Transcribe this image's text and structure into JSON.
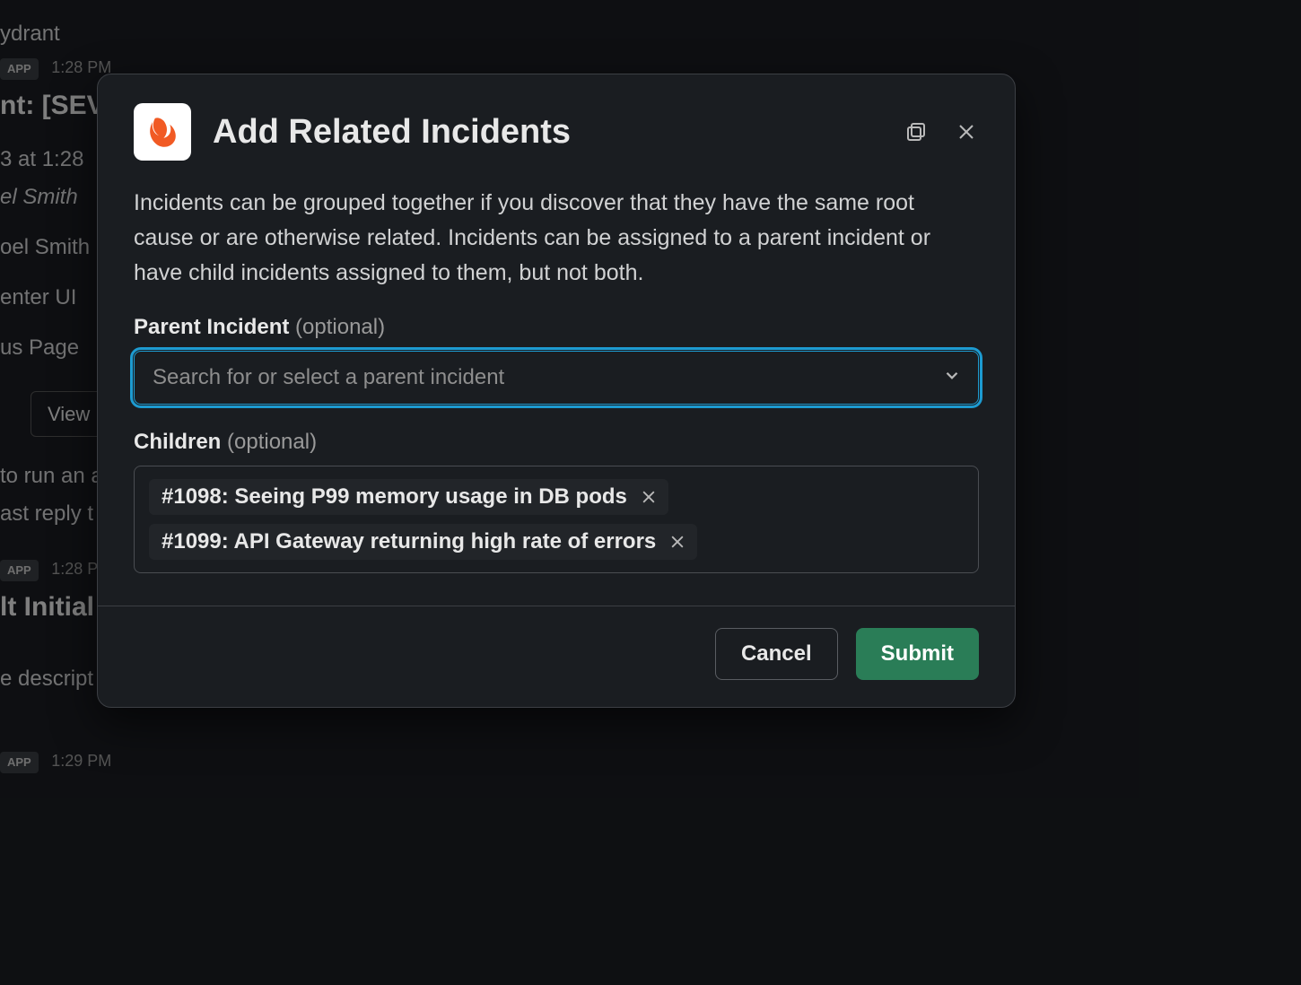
{
  "background": {
    "app_author": "ydrant",
    "app_badge": "APP",
    "time1": "1:28 PM",
    "headline_fragment": "nt: [SEV",
    "time_line": "3 at 1:28",
    "name1": "el Smith",
    "name2": "oel Smith",
    "link1": "enter UI",
    "link2": "us Page",
    "button_fragment": "View",
    "text_line1": "to run an a",
    "text_line2": "ast reply t",
    "time2": "1:28 P",
    "headline2_fragment": "lt Initial",
    "text_line3": "e descript",
    "time3": "1:29 PM"
  },
  "modal": {
    "title": "Add Related Incidents",
    "description": "Incidents can be grouped together if you discover that they have the same root cause or are otherwise related. Incidents can be assigned to a parent incident or have child incidents assigned to them, but not both.",
    "parent_label": "Parent Incident",
    "parent_optional": "(optional)",
    "parent_placeholder": "Search for or select a parent incident",
    "children_label": "Children",
    "children_optional": "(optional)",
    "children": [
      {
        "label": "#1098: Seeing P99 memory usage in DB pods"
      },
      {
        "label": "#1099: API Gateway returning high rate of errors"
      }
    ],
    "cancel_label": "Cancel",
    "submit_label": "Submit"
  }
}
